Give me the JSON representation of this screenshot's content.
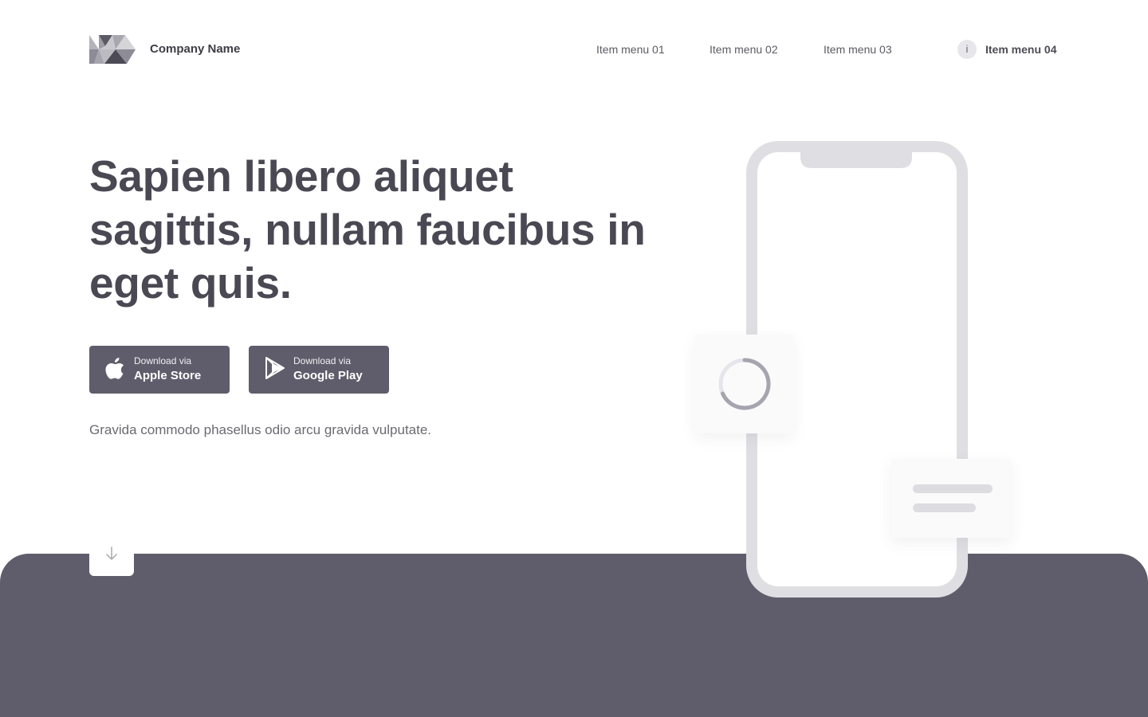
{
  "header": {
    "company_name": "Company Name",
    "logo_icon": "triangles-logo",
    "nav": [
      {
        "label": "Item menu 01"
      },
      {
        "label": "Item menu 02"
      },
      {
        "label": "Item menu 03"
      },
      {
        "label": "Item menu 04",
        "icon_text": "i"
      }
    ]
  },
  "hero": {
    "title": "Sapien libero aliquet sagittis, nullam faucibus in eget quis.",
    "subtitle": "Gravida commodo phasellus odio arcu gravida vulputate.",
    "buttons": [
      {
        "small": "Download via",
        "big": "Apple Store",
        "icon": "apple-icon"
      },
      {
        "small": "Download via",
        "big": "Google Play",
        "icon": "google-play-icon"
      }
    ],
    "scroll_icon": "arrow-down-icon"
  },
  "colors": {
    "primary": "#5f5d6b",
    "heading": "#4a4852",
    "text_muted": "#6c6a72",
    "phone_frame": "#dfdee3",
    "background": "#ffffff"
  }
}
